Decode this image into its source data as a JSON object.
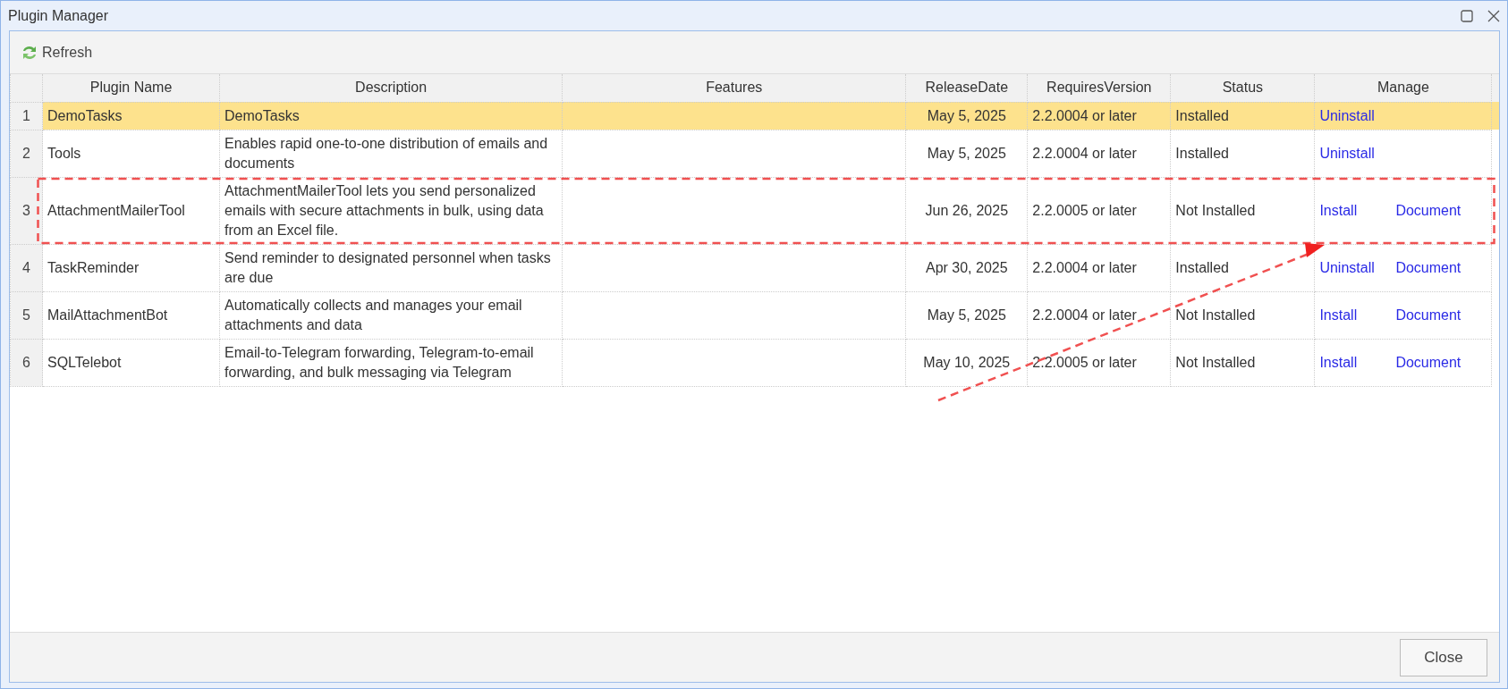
{
  "window": {
    "title": "Plugin Manager"
  },
  "toolbar": {
    "refresh_label": "Refresh"
  },
  "table": {
    "columns": [
      "Plugin Name",
      "Description",
      "Features",
      "ReleaseDate",
      "RequiresVersion",
      "Status",
      "Manage"
    ],
    "rows": [
      {
        "number": "1",
        "name": "DemoTasks",
        "description": "DemoTasks",
        "features": "",
        "release_date": "May 5, 2025",
        "requires_version": "2.2.0004 or later",
        "status": "Installed",
        "action": "Uninstall",
        "document": "",
        "selected": true,
        "highlighted": false
      },
      {
        "number": "2",
        "name": "Tools",
        "description": "Enables rapid one-to-one distribution of emails and documents",
        "features": "",
        "release_date": "May 5, 2025",
        "requires_version": "2.2.0004 or later",
        "status": "Installed",
        "action": "Uninstall",
        "document": "",
        "selected": false,
        "highlighted": false
      },
      {
        "number": "3",
        "name": "AttachmentMailerTool",
        "description": "AttachmentMailerTool lets you send personalized emails with secure attachments in bulk, using data from an Excel file.",
        "features": "",
        "release_date": "Jun 26, 2025",
        "requires_version": "2.2.0005 or later",
        "status": "Not Installed",
        "action": "Install",
        "document": "Document",
        "selected": false,
        "highlighted": true
      },
      {
        "number": "4",
        "name": "TaskReminder",
        "description": "Send reminder to designated personnel when tasks are due",
        "features": "",
        "release_date": "Apr 30, 2025",
        "requires_version": "2.2.0004 or later",
        "status": "Installed",
        "action": "Uninstall",
        "document": "Document",
        "selected": false,
        "highlighted": false
      },
      {
        "number": "5",
        "name": "MailAttachmentBot",
        "description": "Automatically collects and manages your email attachments and data",
        "features": "",
        "release_date": "May 5, 2025",
        "requires_version": "2.2.0004 or later",
        "status": "Not Installed",
        "action": "Install",
        "document": "Document",
        "selected": false,
        "highlighted": false
      },
      {
        "number": "6",
        "name": "SQLTelebot",
        "description": "Email-to-Telegram forwarding, Telegram-to-email forwarding, and bulk messaging via Telegram",
        "features": "",
        "release_date": "May 10, 2025",
        "requires_version": "2.2.0005 or later",
        "status": "Not Installed",
        "action": "Install",
        "document": "Document",
        "selected": false,
        "highlighted": false
      }
    ]
  },
  "footer": {
    "close_label": "Close"
  }
}
